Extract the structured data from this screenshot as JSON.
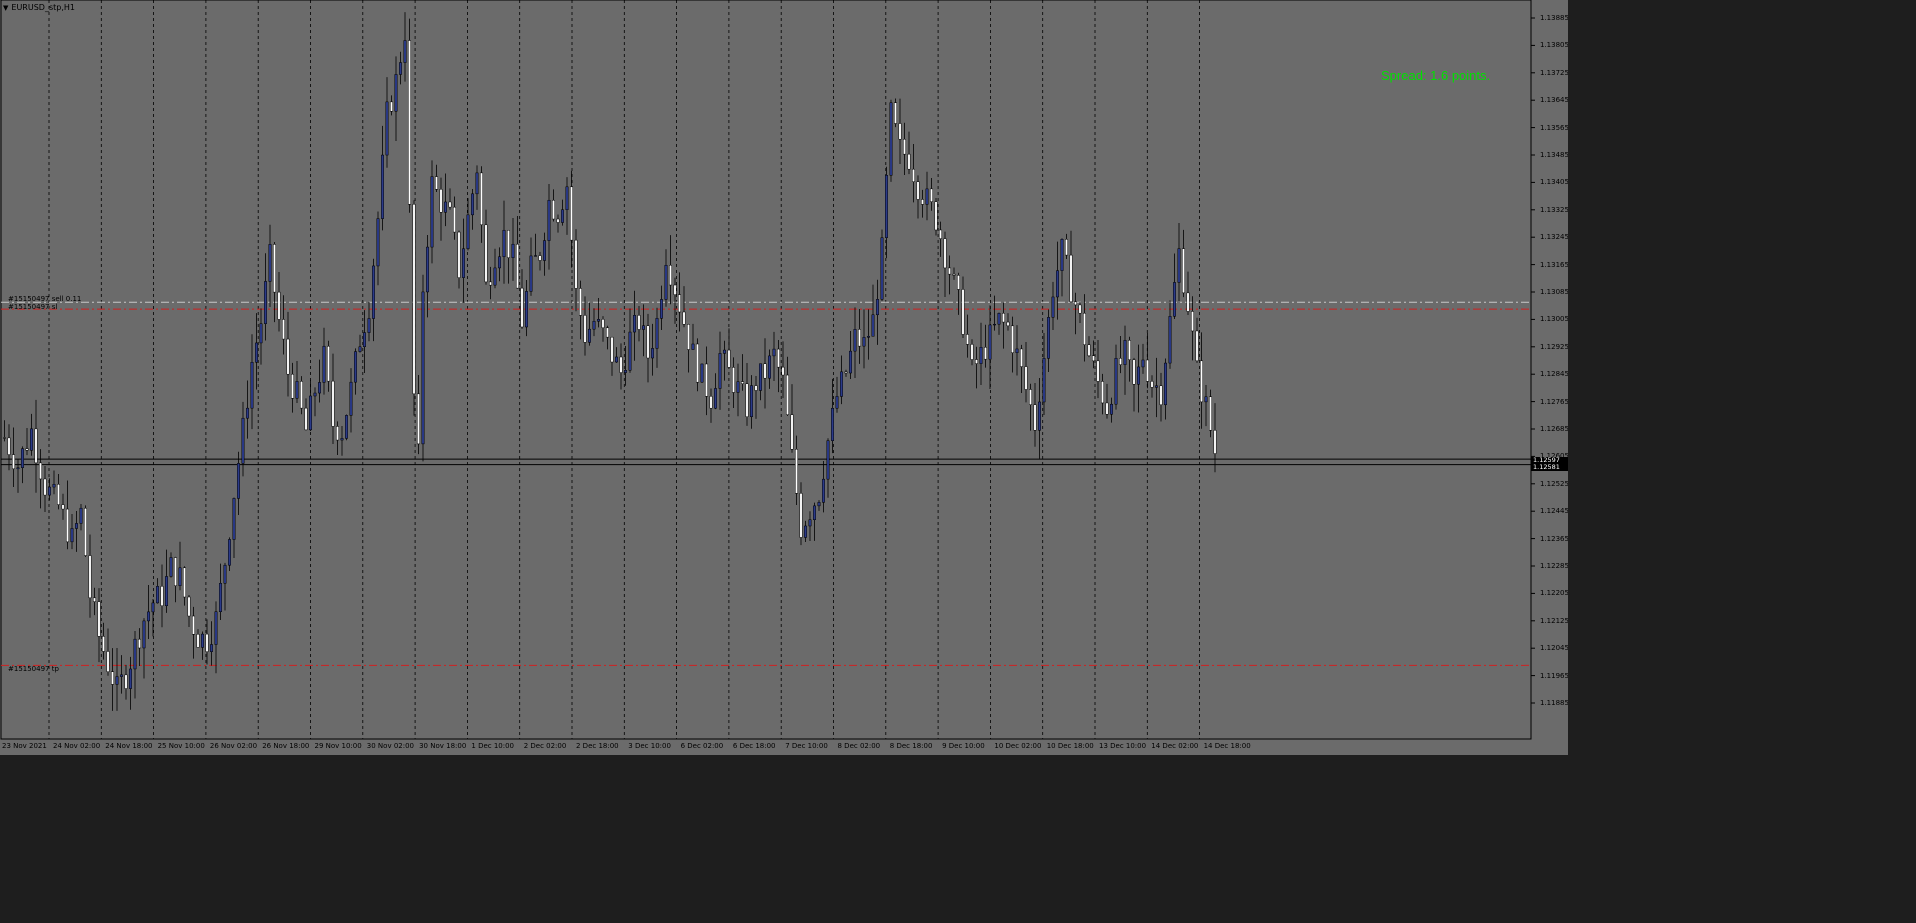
{
  "window": {
    "title": "EURUSD_stp,H1",
    "menu_icon": "triangle-down-icon"
  },
  "spread_text": "Spread: 1.6 points.",
  "order_lines": [
    {
      "label": "#15150497 sell 0.11",
      "price": 1.13055,
      "color": "#c8c8c8"
    },
    {
      "label": "#15150497 sl",
      "price": 1.13035,
      "color": "#d02020"
    },
    {
      "label": "#15150497 tp",
      "price": 1.11995,
      "color": "#d02020"
    }
  ],
  "current_prices": {
    "ask": "1.12597",
    "bid": "1.12581"
  },
  "price_axis": [
    "1.13885",
    "1.13805",
    "1.13725",
    "1.13645",
    "1.13565",
    "1.13485",
    "1.13405",
    "1.13325",
    "1.13245",
    "1.13165",
    "1.13085",
    "1.13005",
    "1.12925",
    "1.12845",
    "1.12765",
    "1.12685",
    "1.12605",
    "1.12525",
    "1.12445",
    "1.12365",
    "1.12285",
    "1.12205",
    "1.12125",
    "1.12045",
    "1.11965",
    "1.11885"
  ],
  "time_axis": [
    "23 Nov 2021",
    "24 Nov 02:00",
    "24 Nov 18:00",
    "25 Nov 10:00",
    "26 Nov 02:00",
    "26 Nov 18:00",
    "29 Nov 10:00",
    "30 Nov 02:00",
    "30 Nov 18:00",
    "1 Dec 10:00",
    "2 Dec 02:00",
    "2 Dec 18:00",
    "3 Dec 10:00",
    "6 Dec 02:00",
    "6 Dec 18:00",
    "7 Dec 10:00",
    "8 Dec 02:00",
    "8 Dec 18:00",
    "9 Dec 10:00",
    "10 Dec 02:00",
    "10 Dec 18:00",
    "13 Dec 10:00",
    "14 Dec 02:00",
    "14 Dec 18:00"
  ],
  "chart_data": {
    "type": "candlestick",
    "symbol": "EURUSD_stp",
    "timeframe": "H1",
    "ylim": [
      1.1183,
      1.1392
    ],
    "grid": "vertical-dashed",
    "close_path": [
      [
        0,
        1.1266
      ],
      [
        3,
        1.1258
      ],
      [
        6,
        1.1268
      ],
      [
        9,
        1.1252
      ],
      [
        12,
        1.1246
      ],
      [
        15,
        1.1236
      ],
      [
        17,
        1.1244
      ],
      [
        19,
        1.122
      ],
      [
        21,
        1.1208
      ],
      [
        23,
        1.12
      ],
      [
        25,
        1.1192
      ],
      [
        27,
        1.1197
      ],
      [
        29,
        1.1205
      ],
      [
        31,
        1.1213
      ],
      [
        33,
        1.1218
      ],
      [
        35,
        1.122
      ],
      [
        37,
        1.1228
      ],
      [
        39,
        1.1225
      ],
      [
        41,
        1.1214
      ],
      [
        43,
        1.1208
      ],
      [
        45,
        1.1207
      ],
      [
        47,
        1.1213
      ],
      [
        49,
        1.123
      ],
      [
        51,
        1.125
      ],
      [
        53,
        1.1268
      ],
      [
        55,
        1.1288
      ],
      [
        57,
        1.13
      ],
      [
        59,
        1.1318
      ],
      [
        61,
        1.13
      ],
      [
        63,
        1.1285
      ],
      [
        65,
        1.1278
      ],
      [
        67,
        1.1268
      ],
      [
        69,
        1.128
      ],
      [
        71,
        1.1289
      ],
      [
        73,
        1.127
      ],
      [
        75,
        1.1268
      ],
      [
        77,
        1.128
      ],
      [
        79,
        1.1295
      ],
      [
        81,
        1.1305
      ],
      [
        83,
        1.133
      ],
      [
        85,
        1.136
      ],
      [
        87,
        1.137
      ],
      [
        89,
        1.1385
      ],
      [
        91,
        1.1278
      ],
      [
        92,
        1.126
      ],
      [
        93,
        1.131
      ],
      [
        95,
        1.134
      ],
      [
        97,
        1.1335
      ],
      [
        99,
        1.133
      ],
      [
        101,
        1.1315
      ],
      [
        103,
        1.133
      ],
      [
        105,
        1.1345
      ],
      [
        107,
        1.131
      ],
      [
        109,
        1.132
      ],
      [
        111,
        1.1325
      ],
      [
        113,
        1.1318
      ],
      [
        115,
        1.13
      ],
      [
        117,
        1.1315
      ],
      [
        119,
        1.132
      ],
      [
        121,
        1.1335
      ],
      [
        123,
        1.1332
      ],
      [
        125,
        1.134
      ],
      [
        127,
        1.1308
      ],
      [
        129,
        1.1296
      ],
      [
        131,
        1.13
      ],
      [
        133,
        1.1296
      ],
      [
        135,
        1.129
      ],
      [
        137,
        1.1285
      ],
      [
        139,
        1.1295
      ],
      [
        141,
        1.13
      ],
      [
        143,
        1.129
      ],
      [
        145,
        1.13
      ],
      [
        147,
        1.132
      ],
      [
        149,
        1.131
      ],
      [
        151,
        1.13
      ],
      [
        153,
        1.129
      ],
      [
        155,
        1.1283
      ],
      [
        157,
        1.1278
      ],
      [
        159,
        1.129
      ],
      [
        161,
        1.1285
      ],
      [
        163,
        1.128
      ],
      [
        165,
        1.1275
      ],
      [
        167,
        1.1282
      ],
      [
        169,
        1.1285
      ],
      [
        171,
        1.129
      ],
      [
        173,
        1.1282
      ],
      [
        175,
        1.126
      ],
      [
        177,
        1.124
      ],
      [
        179,
        1.1245
      ],
      [
        181,
        1.125
      ],
      [
        183,
        1.1265
      ],
      [
        185,
        1.1278
      ],
      [
        187,
        1.1285
      ],
      [
        189,
        1.1295
      ],
      [
        191,
        1.1293
      ],
      [
        193,
        1.13
      ],
      [
        195,
        1.132
      ],
      [
        197,
        1.136
      ],
      [
        199,
        1.135
      ],
      [
        201,
        1.1348
      ],
      [
        203,
        1.134
      ],
      [
        205,
        1.1335
      ],
      [
        207,
        1.133
      ],
      [
        209,
        1.132
      ],
      [
        211,
        1.131
      ],
      [
        213,
        1.13
      ],
      [
        215,
        1.1285
      ],
      [
        217,
        1.129
      ],
      [
        219,
        1.1295
      ],
      [
        221,
        1.13
      ],
      [
        223,
        1.1298
      ],
      [
        225,
        1.129
      ],
      [
        227,
        1.128
      ],
      [
        229,
        1.127
      ],
      [
        231,
        1.129
      ],
      [
        233,
        1.131
      ],
      [
        235,
        1.132
      ],
      [
        237,
        1.131
      ],
      [
        239,
        1.13
      ],
      [
        241,
        1.129
      ],
      [
        243,
        1.1282
      ],
      [
        245,
        1.1275
      ],
      [
        247,
        1.1285
      ],
      [
        249,
        1.129
      ],
      [
        251,
        1.128
      ],
      [
        253,
        1.129
      ],
      [
        255,
        1.1282
      ],
      [
        257,
        1.128
      ],
      [
        259,
        1.13
      ],
      [
        261,
        1.132
      ],
      [
        263,
        1.1305
      ],
      [
        265,
        1.1285
      ],
      [
        267,
        1.1275
      ],
      [
        269,
        1.1262
      ]
    ]
  }
}
